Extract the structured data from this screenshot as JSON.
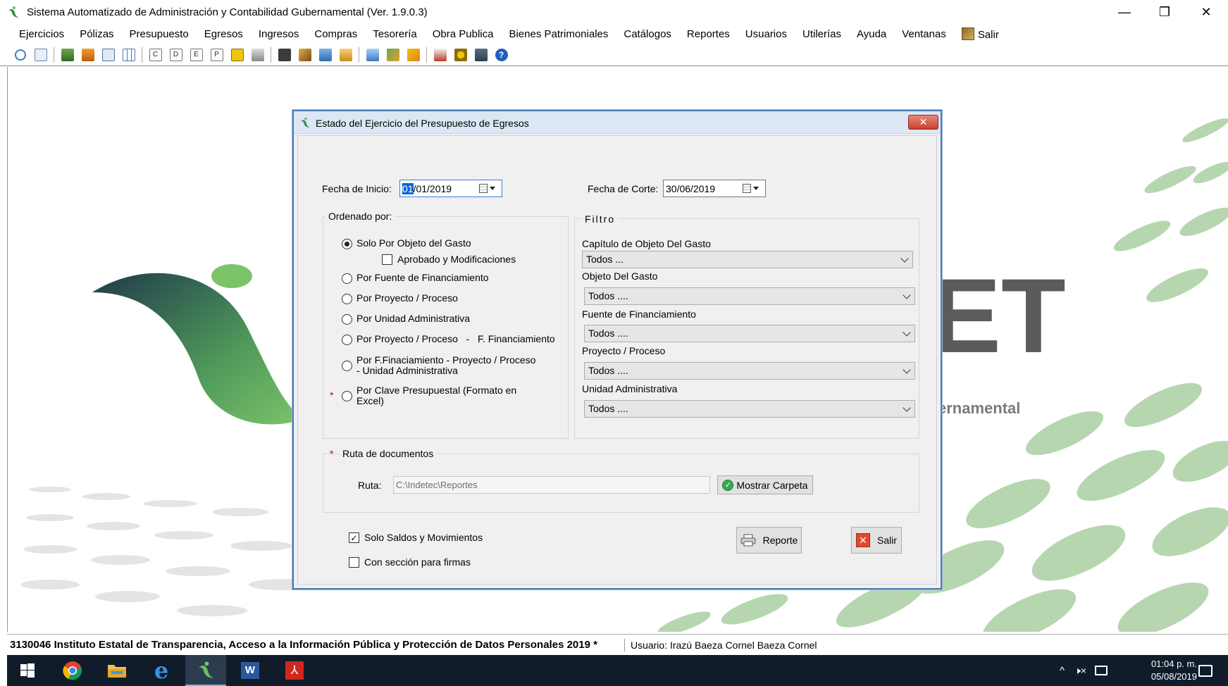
{
  "window": {
    "title": "Sistema Automatizado de Administración y Contabilidad Gubernamental  (Ver. 1.9.0.3)",
    "controls": {
      "minimize": "—",
      "restore": "❐",
      "close": "✕"
    }
  },
  "menu": {
    "items": [
      "Ejercicios",
      "Pólizas",
      "Presupuesto",
      "Egresos",
      "Ingresos",
      "Compras",
      "Tesorería",
      "Obra Publica",
      "Bienes Patrimoniales",
      "Catálogos",
      "Reportes",
      "Usuarios",
      "Utilerías",
      "Ayuda",
      "Ventanas"
    ],
    "exit_label": "Salir"
  },
  "toolbar": {
    "letter_buttons": [
      "C",
      "D",
      "E",
      "P"
    ],
    "help_icon": "?"
  },
  "background": {
    "logo_text": "ET",
    "logo_subtext": "ernamental"
  },
  "dialog": {
    "title": "Estado del Ejercicio del Presupuesto de Egresos",
    "close_label": "✕",
    "fecha_inicio": {
      "label": "Fecha de Inicio:",
      "selected": "01",
      "rest": "/01/2019"
    },
    "fecha_corte": {
      "label": "Fecha de Corte:",
      "value": "30/06/2019"
    },
    "ordenado": {
      "title": "Ordenado por:",
      "option_1": "Solo Por Objeto del Gasto",
      "sub_checkbox": "Aprobado y Modificaciones",
      "option_2": "Por Fuente de Financiamiento",
      "option_3": "Por Proyecto / Proceso",
      "option_4": "Por Unidad Administrativa",
      "option_5": "Por Proyecto / Proceso   -   F. Financiamiento",
      "option_6_line1": "Por F.Finaciamiento - Proyecto / Proceso",
      "option_6_line2": "- Unidad Administrativa",
      "option_7_line1": "Por Clave Presupuestal (Formato en",
      "option_7_line2": "Excel)",
      "required_mark": "*"
    },
    "filtro": {
      "title": "Filtro",
      "capitulo": {
        "label": "Capítulo de Objeto Del Gasto",
        "value": "Todos  ..."
      },
      "objeto": {
        "label": "Objeto Del Gasto",
        "value": "Todos ...."
      },
      "fuente": {
        "label": "Fuente de Financiamiento",
        "value": "Todos ...."
      },
      "proyecto": {
        "label": "Proyecto / Proceso",
        "value": "Todos ...."
      },
      "unidad": {
        "label": "Unidad Administrativa",
        "value": "Todos ...."
      }
    },
    "ruta": {
      "required_mark": "*",
      "title": "Ruta de documentos",
      "label": "Ruta:",
      "value": "C:\\Indetec\\Reportes",
      "show_folder": "Mostrar Carpeta"
    },
    "check_saldos": "Solo Saldos y Movimientos",
    "check_firmas": "Con sección para firmas",
    "reporte_button": "Reporte",
    "salir_button": "Salir"
  },
  "statusbar": {
    "org": "3130046 Instituto Estatal de Transparencia, Acceso a la Información Pública y Protección de Datos Personales  2019   *",
    "user": "Usuario: Irazú Baeza Cornel Baeza Cornel"
  },
  "taskbar": {
    "time": "01:04 p. m.",
    "date": "05/08/2019",
    "tray_chevron": "^",
    "volume": "🕨×"
  },
  "colors": {
    "accent": "#0a64d6",
    "dialog_border": "#4a79b6",
    "close_red": "#c9402d",
    "leaf_green": "#6bbf5f",
    "taskbar": "#101c2a"
  }
}
